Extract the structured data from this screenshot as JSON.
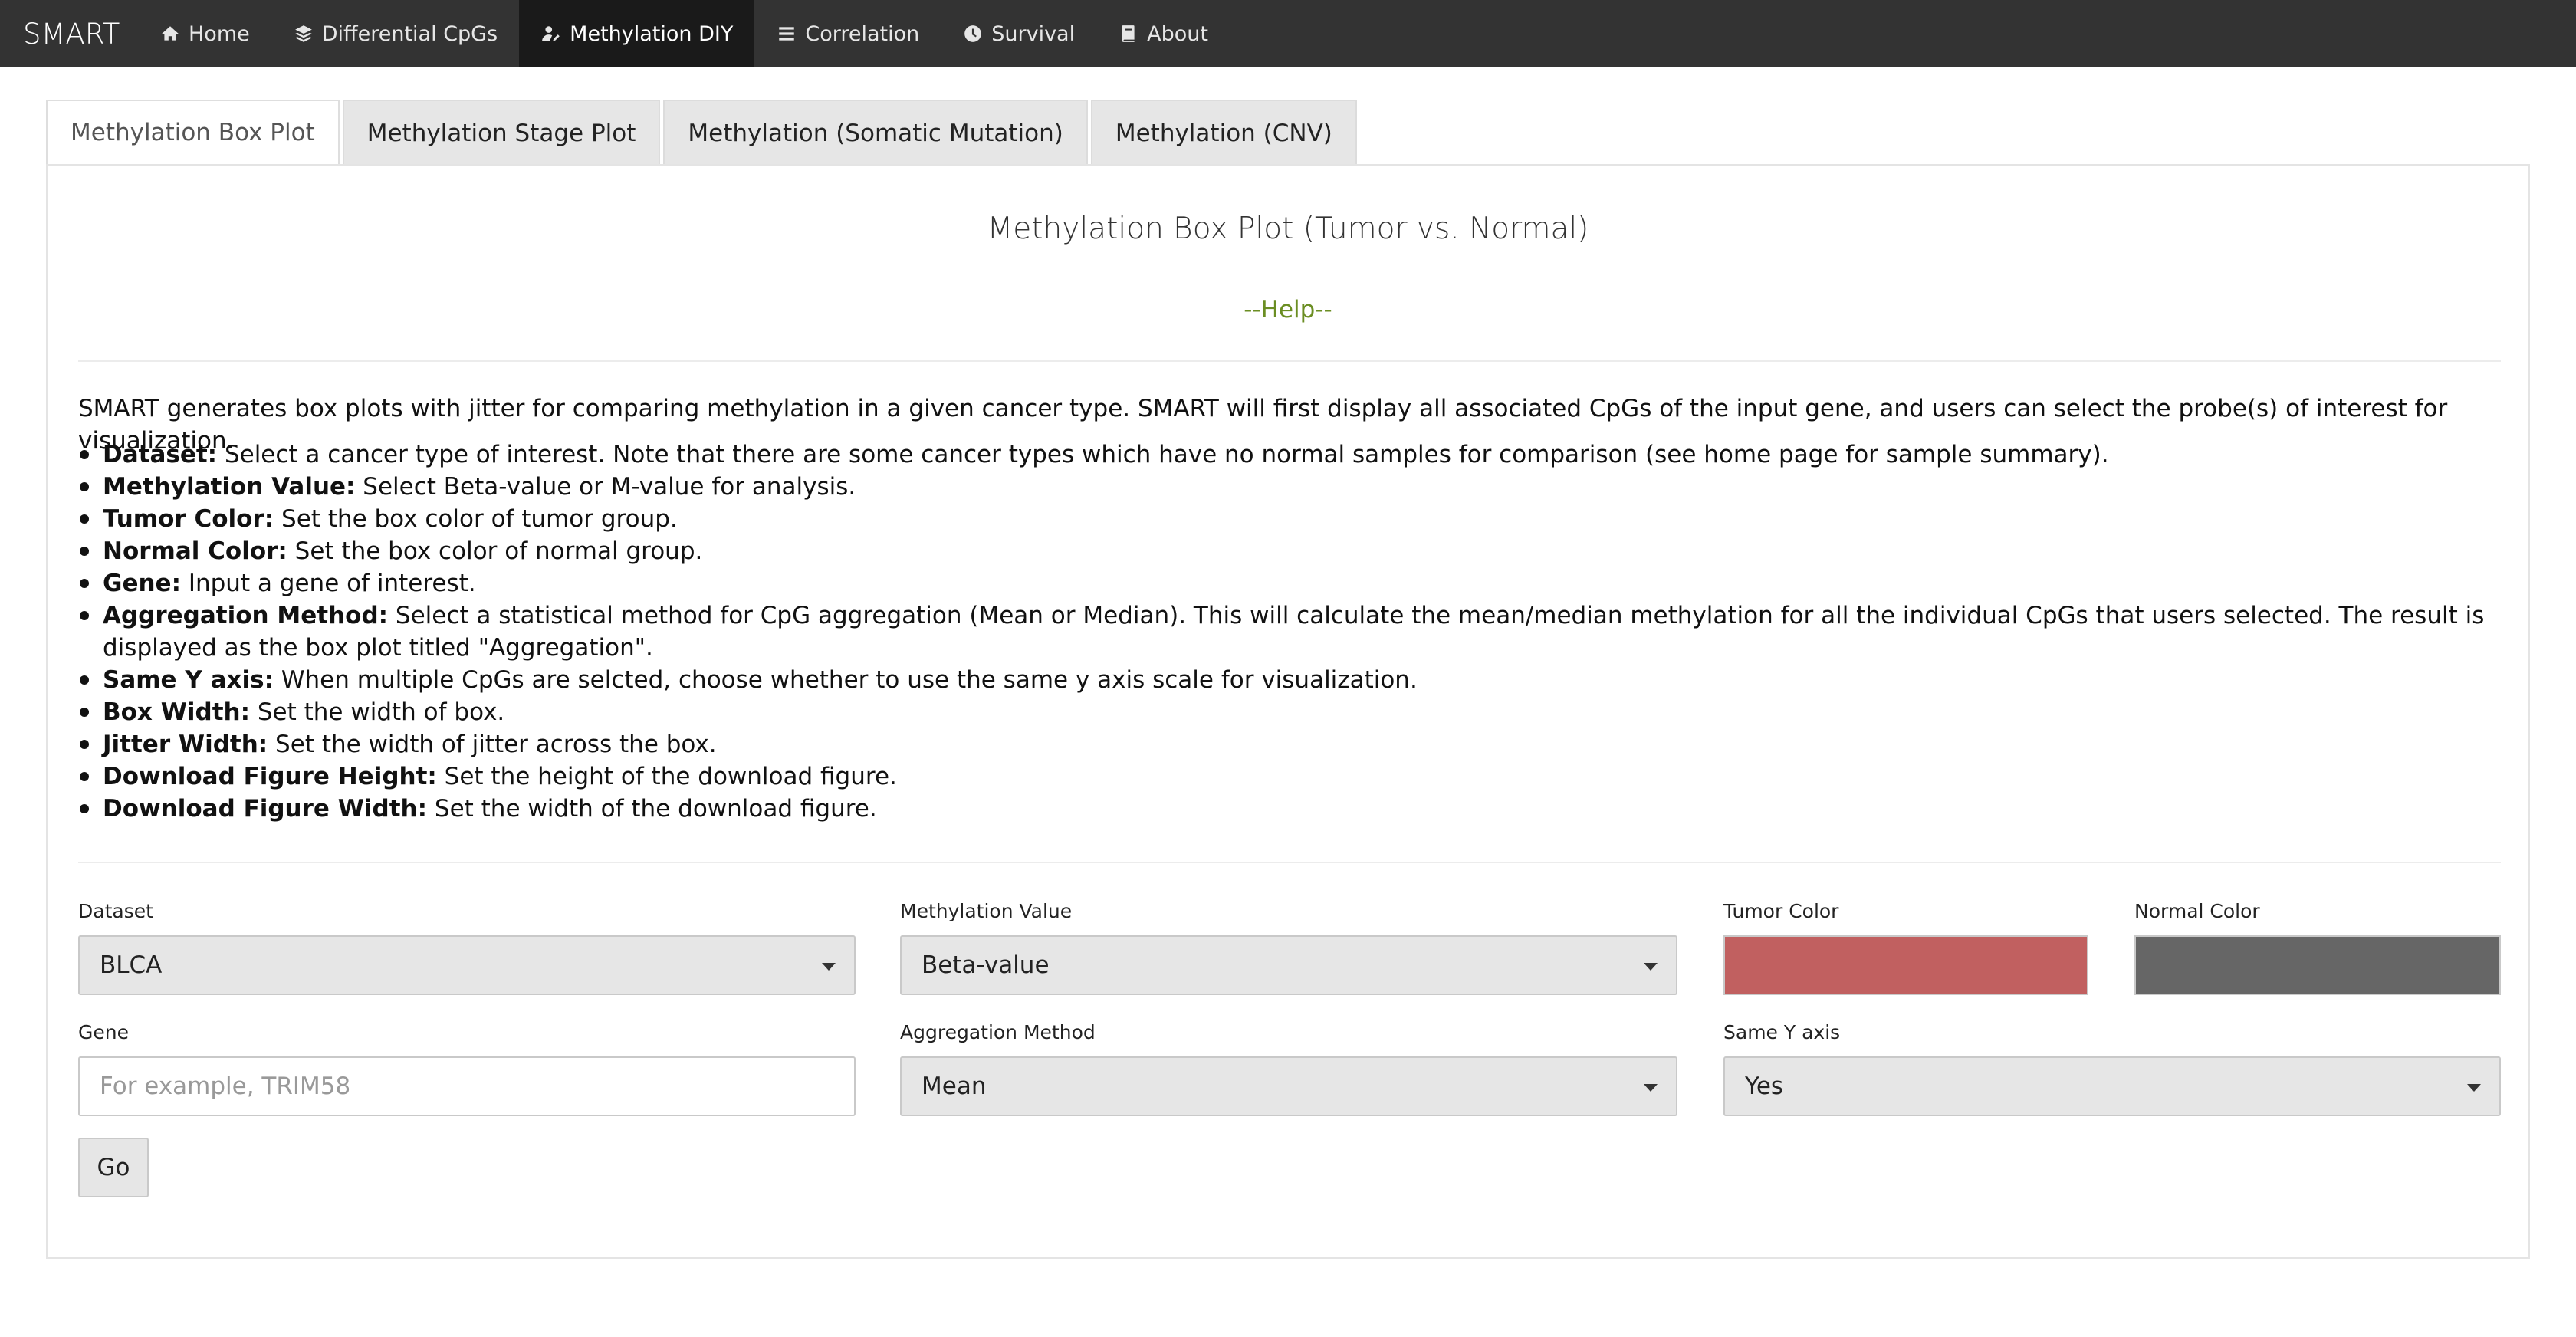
{
  "brand": "SMART",
  "nav": [
    {
      "label": "Home",
      "icon": "home-icon"
    },
    {
      "label": "Differential CpGs",
      "icon": "layers-icon"
    },
    {
      "label": "Methylation DIY",
      "icon": "user-edit-icon"
    },
    {
      "label": "Correlation",
      "icon": "bars-icon"
    },
    {
      "label": "Survival",
      "icon": "clock-icon"
    },
    {
      "label": "About",
      "icon": "book-icon"
    }
  ],
  "tabs": [
    "Methylation Box Plot",
    "Methylation Stage Plot",
    "Methylation (Somatic Mutation)",
    "Methylation (CNV)"
  ],
  "panel": {
    "title": "Methylation Box Plot (Tumor vs. Normal)",
    "help": "--Help--",
    "intro": "SMART generates box plots with jitter for comparing methylation in a given cancer type. SMART will first display all associated CpGs of the input gene, and users can select the probe(s) of interest for visualization.",
    "bullets": [
      {
        "term": "Dataset:",
        "text": " Select a cancer type of interest. Note that there are some cancer types which have no normal samples for comparison (see home page for sample summary)."
      },
      {
        "term": "Methylation Value:",
        "text": " Select Beta-value or M-value for analysis."
      },
      {
        "term": "Tumor Color:",
        "text": " Set the box color of tumor group."
      },
      {
        "term": "Normal Color:",
        "text": " Set the box color of normal group."
      },
      {
        "term": "Gene:",
        "text": " Input a gene of interest."
      },
      {
        "term": "Aggregation Method:",
        "text": " Select a statistical method for CpG aggregation (Mean or Median). This will calculate the mean/median methylation for all the individual CpGs that users selected. The result is displayed as the box plot titled \"Aggregation\"."
      },
      {
        "term": "Same Y axis:",
        "text": " When multiple CpGs are selcted, choose whether to use the same y axis scale for visualization."
      },
      {
        "term": "Box Width:",
        "text": " Set the width of box."
      },
      {
        "term": "Jitter Width:",
        "text": " Set the width of jitter across the box."
      },
      {
        "term": "Download Figure Height:",
        "text": " Set the height of the download figure."
      },
      {
        "term": "Download Figure Width:",
        "text": " Set the width of the download figure."
      }
    ]
  },
  "form": {
    "dataset": {
      "label": "Dataset",
      "value": "BLCA"
    },
    "methylation_value": {
      "label": "Methylation Value",
      "value": "Beta-value"
    },
    "tumor_color": {
      "label": "Tumor Color",
      "color": "#c16060"
    },
    "normal_color": {
      "label": "Normal Color",
      "color": "#666666"
    },
    "gene": {
      "label": "Gene",
      "value": "",
      "placeholder": "For example, TRIM58"
    },
    "aggregation": {
      "label": "Aggregation Method",
      "value": "Mean"
    },
    "same_y": {
      "label": "Same Y axis",
      "value": "Yes"
    },
    "go": "Go"
  }
}
